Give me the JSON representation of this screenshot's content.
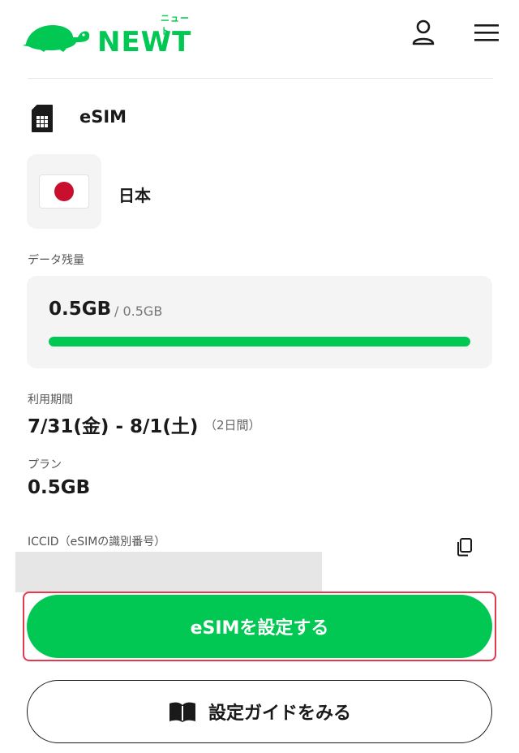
{
  "header": {
    "logo_text": "NEWT",
    "logo_kana": "ニュート",
    "brand_color": "#00c853"
  },
  "esim": {
    "label": "eSIM",
    "icon": "sim-card-icon"
  },
  "country": {
    "name": "日本",
    "flag_icon": "japan-flag-icon"
  },
  "data_balance": {
    "label": "データ残量",
    "used": "0.5GB",
    "total": "/ 0.5GB",
    "progress_fraction": 1.0
  },
  "usage_period": {
    "label": "利用期間",
    "value": "7/31(金) - 8/1(土)",
    "days": "（2日間）"
  },
  "plan": {
    "label": "プラン",
    "value": "0.5GB"
  },
  "iccid": {
    "label": "ICCID（eSIMの識別番号）",
    "copy_icon": "copy-icon"
  },
  "actions": {
    "setup_label": "eSIMを設定する",
    "guide_label": "設定ガイドをみる",
    "highlight_color": "#e53950"
  }
}
